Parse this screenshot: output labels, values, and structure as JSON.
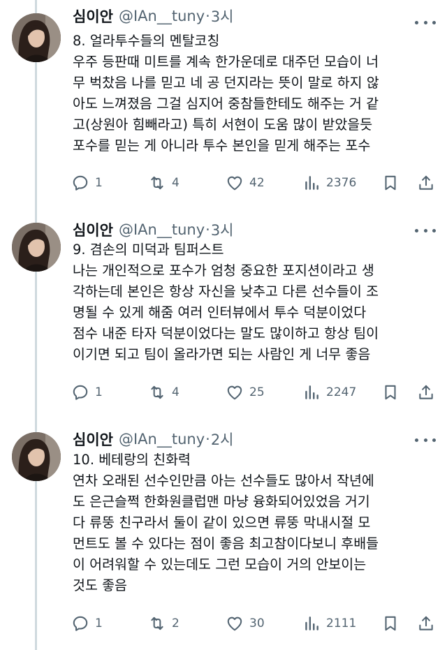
{
  "tweets": [
    {
      "author": {
        "name": "심이안",
        "handle": "@IAn__tuny",
        "time": "3시"
      },
      "title": "8. 얼라투수들의 멘탈코칭",
      "lines": [
        "우주 등판때 미트를 계속 한가운데로 대주던 모습이 너",
        "무 벅찼음 나를 믿고 네 공 던지라는 뜻이 말로 하지 않",
        "아도 느껴졌음 그걸 심지어 중참들한테도 해주는 거 같",
        "고(상원아 힘빼라고) 특히 서현이 도움 많이 받았을듯",
        "포수를 믿는 게 아니라 투수 본인을 믿게 해주는 포수"
      ],
      "stats": {
        "replies": "1",
        "retweets": "4",
        "likes": "42",
        "views": "2376"
      }
    },
    {
      "author": {
        "name": "심이안",
        "handle": "@IAn__tuny",
        "time": "3시"
      },
      "title": "9. 겸손의 미덕과 팀퍼스트",
      "lines": [
        "나는 개인적으로 포수가 엄청 중요한 포지션이라고 생",
        "각하는데 본인은 항상 자신을 낮추고 다른 선수들이 조",
        "명될 수 있게 해줌 여러 인터뷰에서 투수 덕분이었다",
        "점수 내준 타자 덕분이었다는 말도 많이하고 항상 팀이",
        "이기면 되고 팀이 올라가면 되는 사람인 게 너무 좋음"
      ],
      "stats": {
        "replies": "1",
        "retweets": "4",
        "likes": "25",
        "views": "2247"
      }
    },
    {
      "author": {
        "name": "심이안",
        "handle": "@IAn__tuny",
        "time": "2시"
      },
      "title": "10. 베테랑의 친화력",
      "lines": [
        "연차 오래된 선수인만큼 아는 선수들도 많아서 작년에",
        "도 은근슬쩍 한화원클럽맨 마냥 융화되어있었음 거기",
        "다 류뚱 친구라서 둘이 같이 있으면 류뚱 막내시절 모",
        "먼트도 볼 수 있다는 점이 좋음 최고참이다보니 후배들",
        "이 어려워할 수 있는데도 그런 모습이 거의 안보이는",
        "것도 좋음"
      ],
      "stats": {
        "replies": "1",
        "retweets": "2",
        "likes": "30",
        "views": "2111"
      }
    }
  ],
  "icons": {
    "reply": "reply-icon",
    "retweet": "retweet-icon",
    "like": "heart-icon",
    "views": "views-icon",
    "bookmark": "bookmark-icon",
    "share": "share-icon",
    "more": "more-icon"
  },
  "colors": {
    "text": "#0f1419",
    "muted": "#536471",
    "thread_line": "#cfd9de"
  }
}
